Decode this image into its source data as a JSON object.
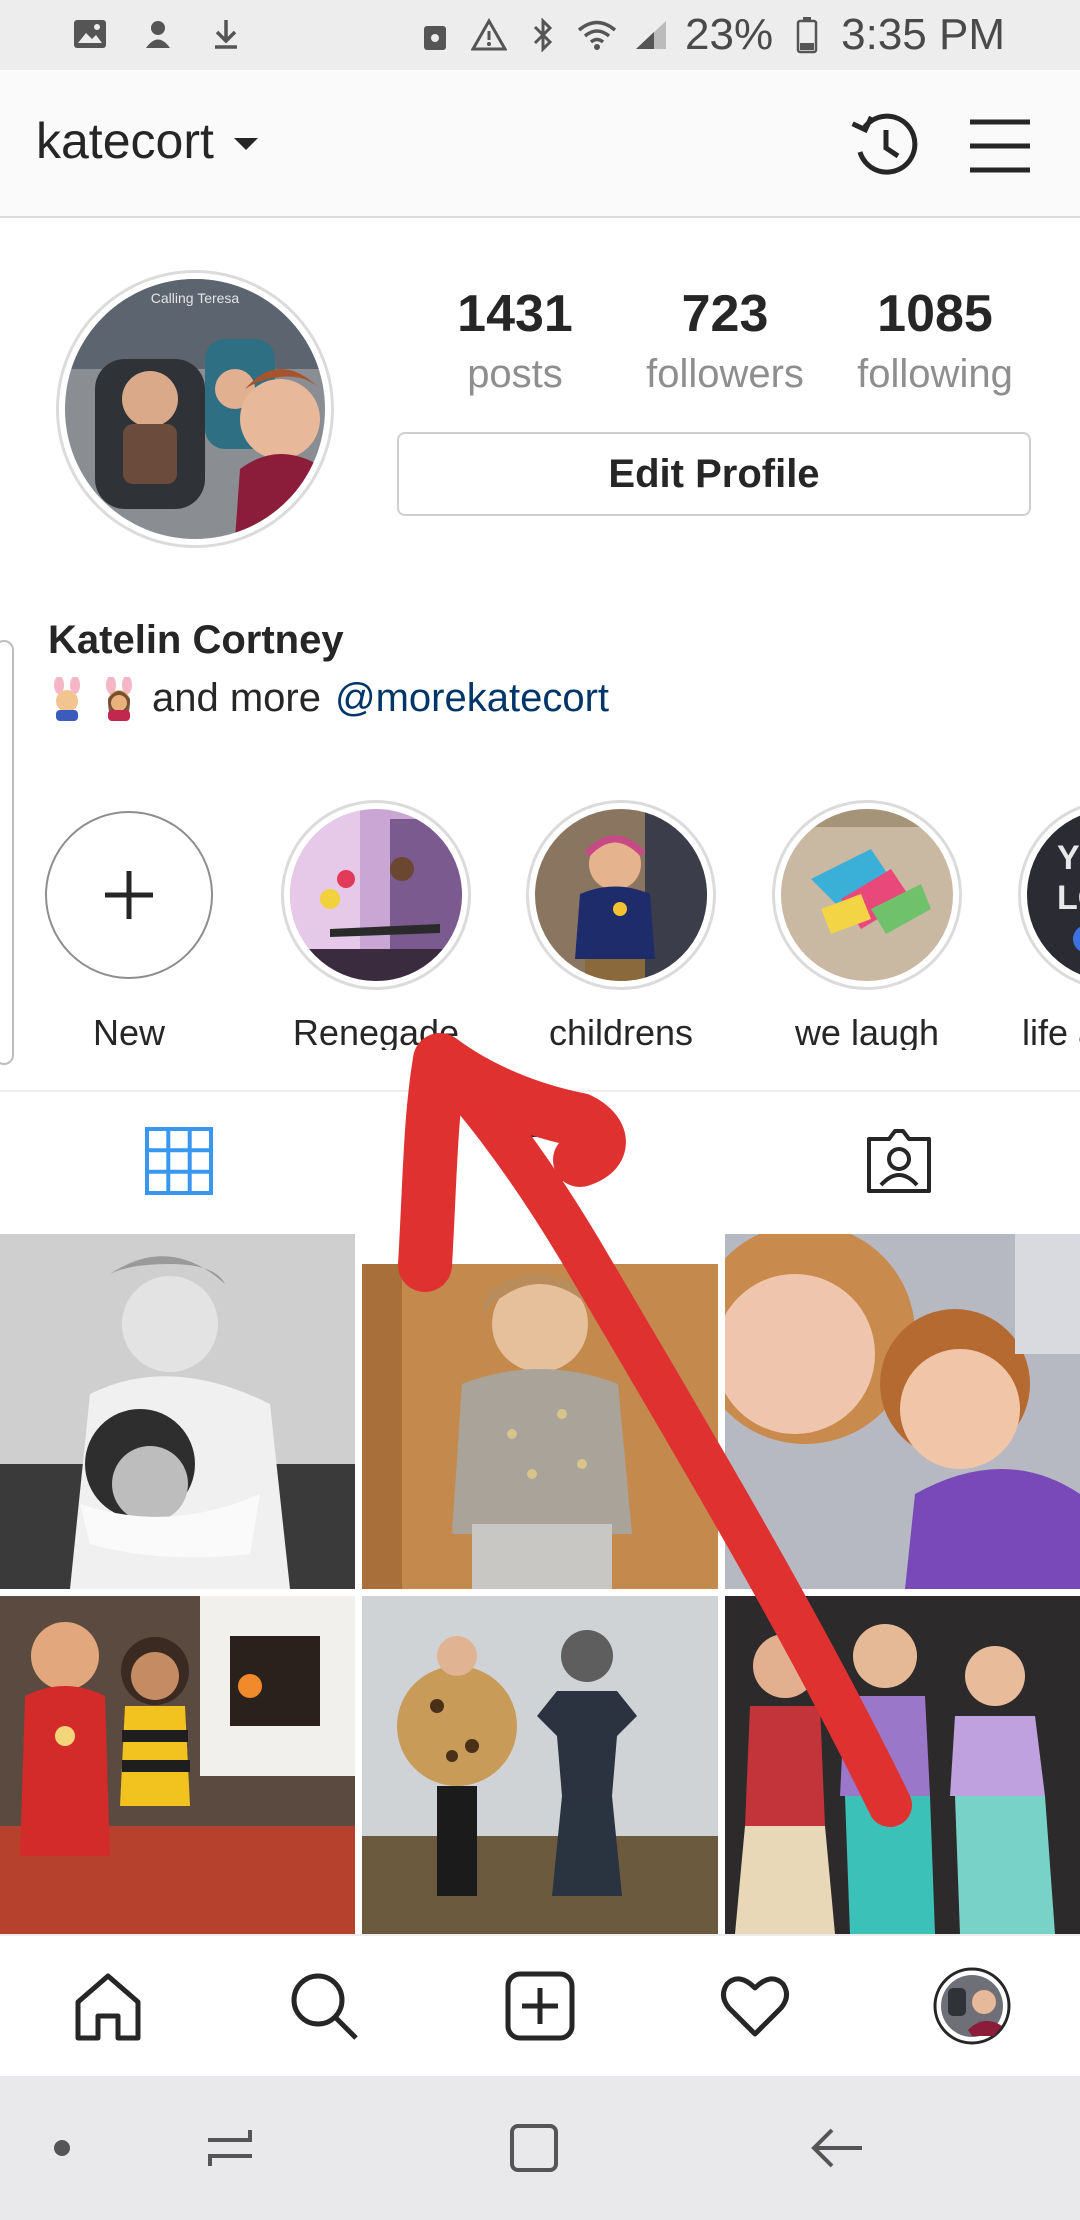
{
  "status_bar": {
    "battery": "23%",
    "time": "3:35 PM",
    "icons": [
      "image-icon",
      "person-icon",
      "download-icon",
      "lock-icon",
      "warning-icon",
      "bluetooth-icon",
      "wifi-icon",
      "signal-icon",
      "battery-icon"
    ]
  },
  "header": {
    "username": "katecort",
    "icons": [
      "history-icon",
      "menu-icon"
    ]
  },
  "profile": {
    "avatar_caption": "Calling Teresa",
    "stats": [
      {
        "value": "1431",
        "label": "posts"
      },
      {
        "value": "723",
        "label": "followers"
      },
      {
        "value": "1085",
        "label": "following"
      }
    ],
    "edit_label": "Edit Profile",
    "full_name": "Katelin Cortney",
    "bio_text": "and more",
    "bio_link": "@morekatecort"
  },
  "highlights": [
    {
      "label": "New"
    },
    {
      "label": "Renegade"
    },
    {
      "label": "childrens"
    },
    {
      "label": "we laugh"
    },
    {
      "label": "life a"
    }
  ],
  "tabs": [
    "grid-icon",
    "tagged-icon"
  ],
  "colors": {
    "accent_blue": "#3897f0",
    "link": "#003569",
    "annotation_arrow": "#e03131"
  },
  "bottom_nav": [
    "home-icon",
    "search-icon",
    "add-post-icon",
    "heart-icon",
    "profile-avatar-icon"
  ],
  "system_nav": [
    "dot-icon",
    "recents-icon",
    "home-square-icon",
    "back-icon"
  ]
}
